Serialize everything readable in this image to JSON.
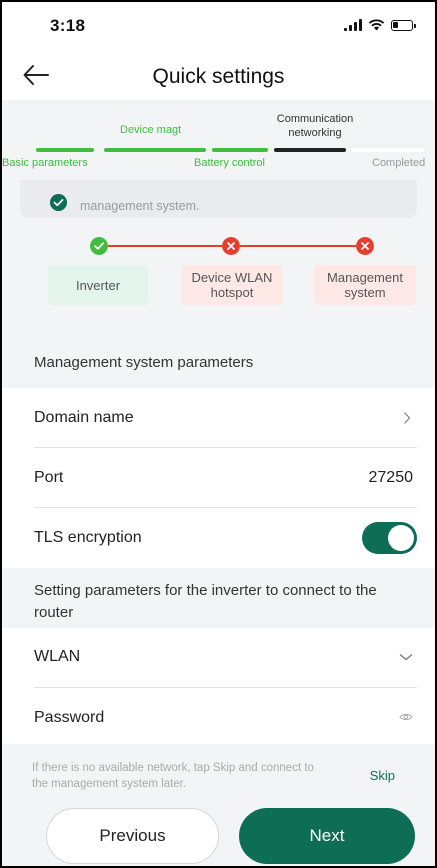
{
  "status_bar": {
    "time": "3:18"
  },
  "header": {
    "title": "Quick settings"
  },
  "steps": {
    "top_labels": [
      "Device magt",
      "Communication networking"
    ],
    "bottom_labels": [
      "Basic parameters",
      "Battery control",
      "Completed"
    ]
  },
  "notice": {
    "text": "management system."
  },
  "connection": {
    "nodes": [
      "Inverter",
      "Device WLAN hotspot",
      "Management system"
    ],
    "status": [
      "ok",
      "error",
      "error"
    ]
  },
  "management": {
    "section_title": "Management system parameters",
    "domain_label": "Domain name",
    "port_label": "Port",
    "port_value": "27250",
    "tls_label": "TLS encryption",
    "tls_enabled": true
  },
  "router": {
    "section_title": "Setting parameters for the inverter to connect to the router",
    "wlan_label": "WLAN",
    "password_label": "Password"
  },
  "footer": {
    "hint": "If there is no available network, tap Skip and connect to the management system later.",
    "skip_label": "Skip",
    "previous_label": "Previous",
    "next_label": "Next"
  },
  "colors": {
    "accent": "#0d6e55",
    "step_done": "#3fbd3f",
    "step_current": "#222222",
    "error": "#e53e2e"
  }
}
